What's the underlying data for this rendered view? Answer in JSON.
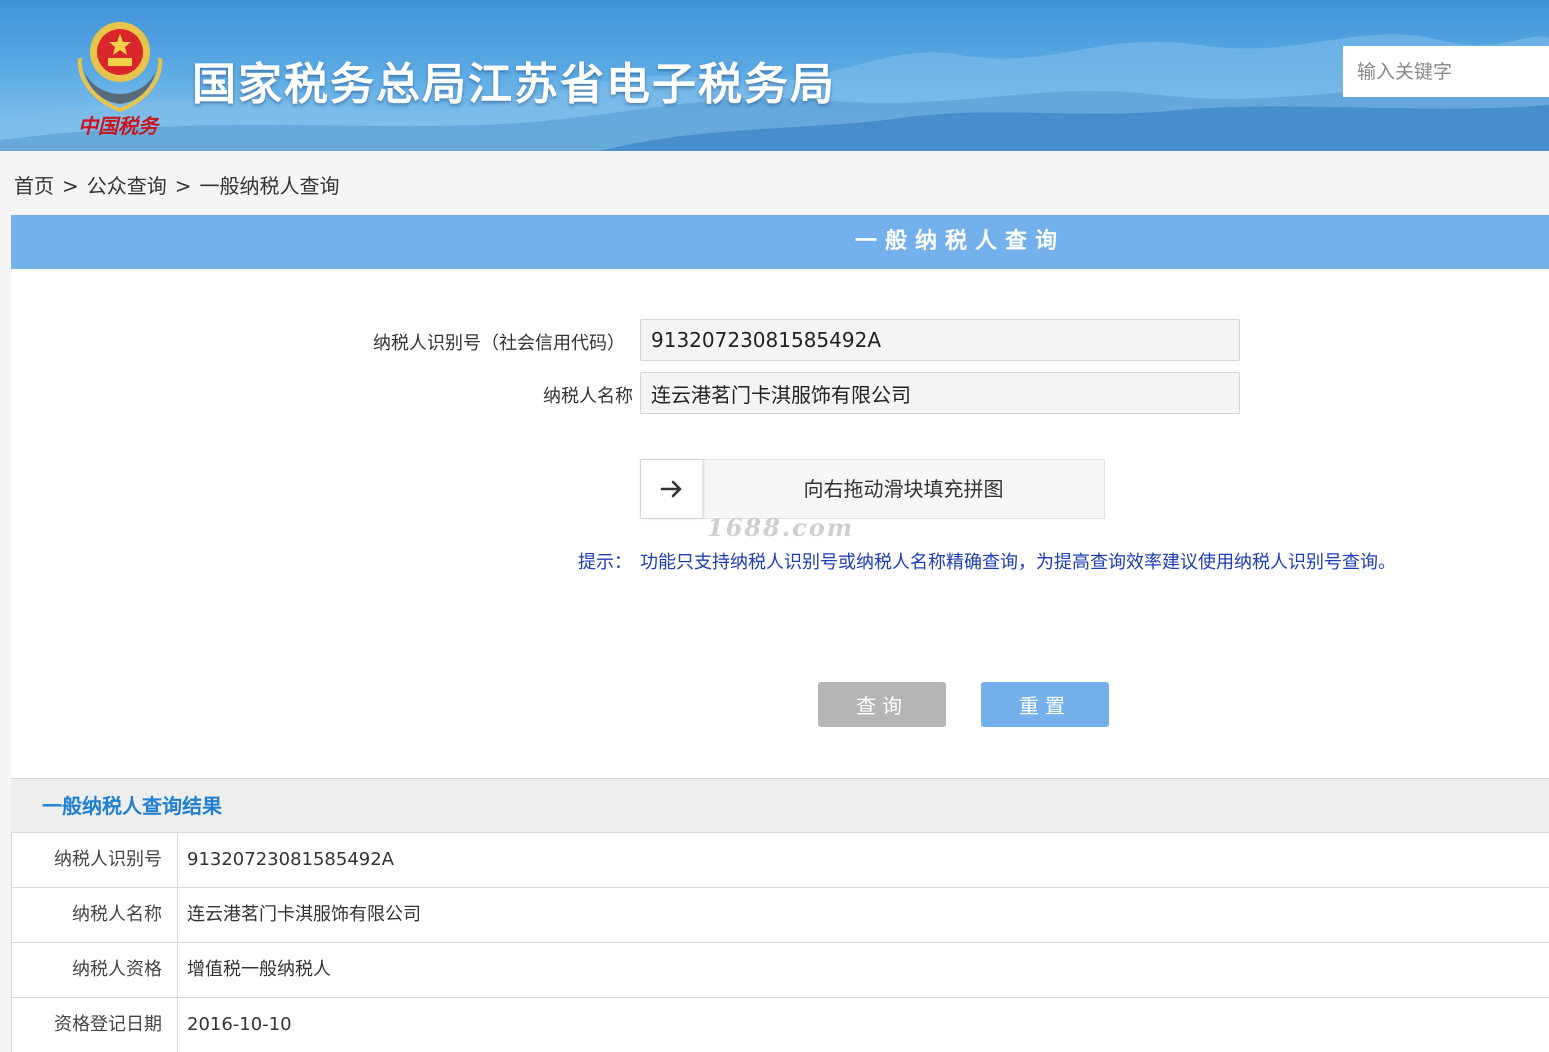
{
  "header": {
    "logo_text": "中国税务",
    "site_title": "国家税务总局江苏省电子税务局",
    "search_placeholder": "输入关键字"
  },
  "breadcrumb": {
    "items": [
      "首页",
      "公众查询",
      "一般纳税人查询"
    ],
    "separator": ">"
  },
  "query_panel": {
    "title": "一般纳税人查询",
    "fields": {
      "taxpayer_id_label": "纳税人识别号（社会信用代码）",
      "taxpayer_id_value": "91320723081585492A",
      "taxpayer_name_label": "纳税人名称",
      "taxpayer_name_value": "连云港茗门卡淇服饰有限公司"
    },
    "slider": {
      "handle_icon": "arrow-right-icon",
      "text": "向右拖动滑块填充拼图"
    },
    "watermark": "1688.com",
    "hint_label": "提示：",
    "hint_text": "功能只支持纳税人识别号或纳税人名称精确查询，为提高查询效率建议使用纳税人识别号查询。",
    "query_button": "查询",
    "reset_button": "重置"
  },
  "results": {
    "title": "一般纳税人查询结果",
    "rows": [
      {
        "key": "纳税人识别号",
        "value": "91320723081585492A"
      },
      {
        "key": "纳税人名称",
        "value": "连云港茗门卡淇服饰有限公司"
      },
      {
        "key": "纳税人资格",
        "value": "增值税一般纳税人"
      },
      {
        "key": "资格登记日期",
        "value": "2016-10-10"
      }
    ]
  },
  "colors": {
    "banner_blue": "#3e93d8",
    "panel_header": "#74b1ec",
    "result_title": "#1f7fd0",
    "hint_text": "#1c3db8",
    "query_button_disabled": "#b5b5b5",
    "reset_button": "#74b1ec"
  }
}
